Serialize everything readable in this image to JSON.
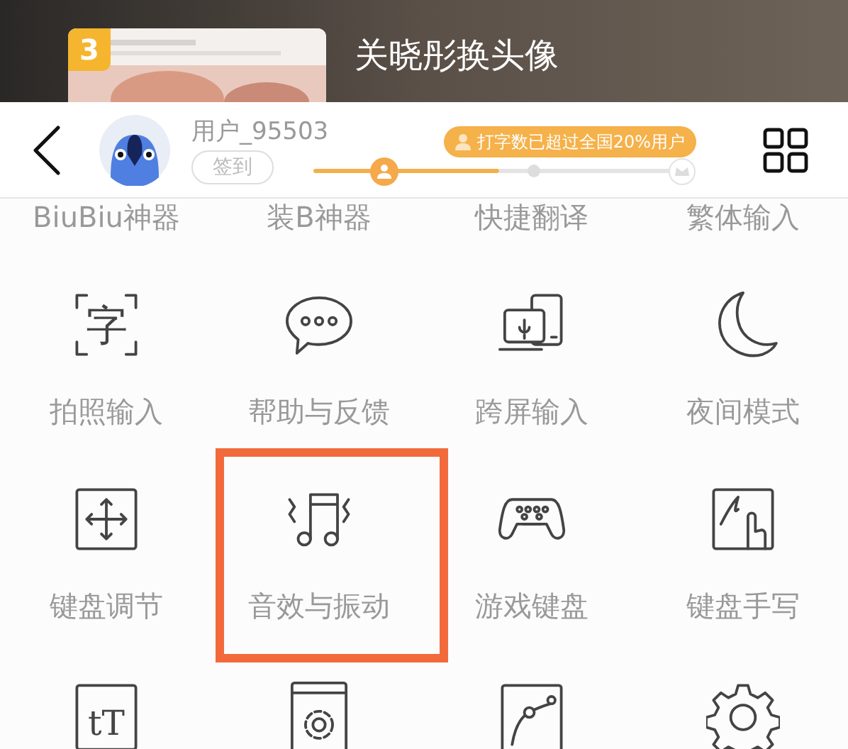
{
  "banner": {
    "rank": "3",
    "title": "关晓彤换头像"
  },
  "header": {
    "username": "用户_95503",
    "checkin_button": "签到",
    "achievement": "打字数已超过全国20%用户",
    "progress": {
      "level": 0.5
    }
  },
  "grid_rows": [
    {
      "items": [
        {
          "label": "BiuBiu神器",
          "highlighted": false
        },
        {
          "label": "装B神器",
          "highlighted": false
        },
        {
          "label": "快捷翻译",
          "highlighted": false
        },
        {
          "label": "繁体输入",
          "highlighted": false
        }
      ]
    },
    {
      "items": [
        {
          "label": "拍照输入",
          "kind": "scan-text",
          "icon_text": "字",
          "highlighted": false
        },
        {
          "label": "帮助与反馈",
          "kind": "chat",
          "highlighted": false
        },
        {
          "label": "跨屏输入",
          "kind": "cross-screen",
          "highlighted": false
        },
        {
          "label": "夜间模式",
          "kind": "moon",
          "highlighted": false
        }
      ]
    },
    {
      "items": [
        {
          "label": "键盘调节",
          "kind": "move",
          "highlighted": false
        },
        {
          "label": "音效与振动",
          "kind": "music",
          "highlighted": true
        },
        {
          "label": "游戏键盘",
          "kind": "gamepad",
          "highlighted": false
        },
        {
          "label": "键盘手写",
          "kind": "handwrite",
          "highlighted": false
        }
      ]
    },
    {
      "items": [
        {
          "kind": "text-size",
          "icon_text": "tT",
          "highlighted": false
        },
        {
          "kind": "settings-card",
          "highlighted": false
        },
        {
          "kind": "curve",
          "highlighted": false
        },
        {
          "kind": "gear",
          "highlighted": false
        }
      ]
    }
  ]
}
